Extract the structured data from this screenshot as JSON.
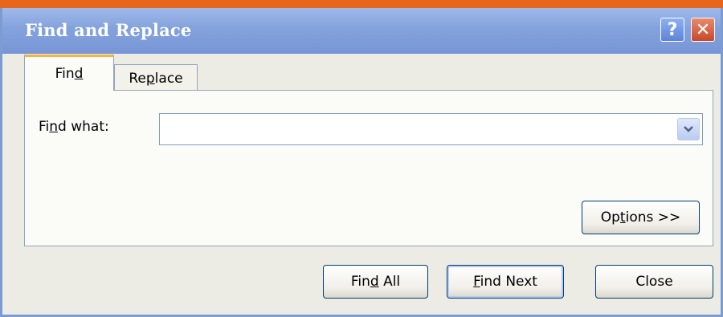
{
  "window": {
    "title": "Find and Replace",
    "help_label": "?",
    "close_label": "✕"
  },
  "tabs": {
    "find": {
      "pre": "Fin",
      "accel": "d",
      "post": ""
    },
    "replace": {
      "pre": "Re",
      "accel": "p",
      "post": "lace"
    },
    "active": "Find"
  },
  "find_what": {
    "label_pre": "Fi",
    "label_accel": "n",
    "label_post": "d what:",
    "value": ""
  },
  "buttons": {
    "options": {
      "pre": "Op",
      "accel": "t",
      "post": "ions >>"
    },
    "find_all": {
      "pre": "Fin",
      "accel": "d",
      "post": " All"
    },
    "find_next": {
      "pre": "",
      "accel": "F",
      "post": "ind Next"
    },
    "close": {
      "pre": "Close",
      "accel": "",
      "post": ""
    }
  },
  "icons": {
    "dropdown": "chevron-down-icon",
    "help": "help-icon",
    "close": "close-icon"
  },
  "colors": {
    "titlebar": "#7896d6",
    "active_tab_accent": "#f5b344",
    "close_button": "#c9482b",
    "dialog_bg": "#ecebe4"
  }
}
